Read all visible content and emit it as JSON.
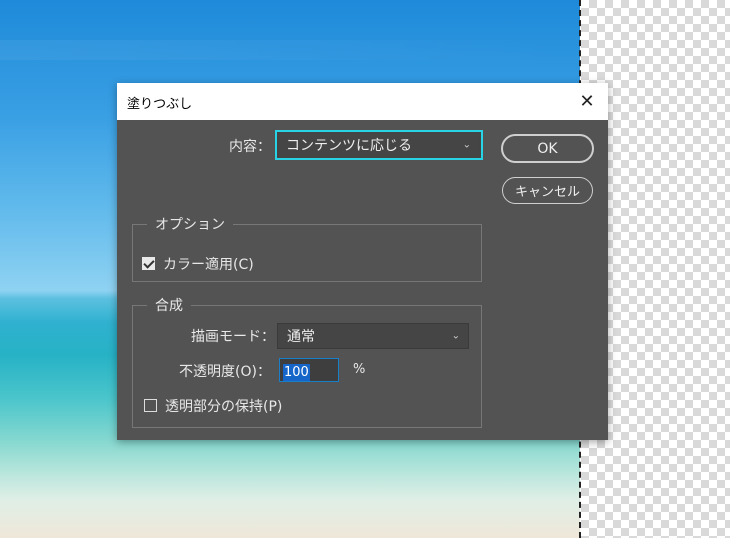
{
  "dialog": {
    "title": "塗りつぶし",
    "close_glyph": "✕",
    "contents_label": "内容：",
    "contents_value": "コンテンツに応じる",
    "ok_label": "OK",
    "cancel_label": "キャンセル",
    "options_group": {
      "title": "オプション",
      "color_adapt_label": "カラー適用(C)",
      "color_adapt_checked": true
    },
    "blending_group": {
      "title": "合成",
      "mode_label": "描画モード：",
      "mode_value": "通常",
      "opacity_label": "不透明度(O)：",
      "opacity_value": "100",
      "opacity_unit": "%",
      "preserve_transparency_label": "透明部分の保持(P)",
      "preserve_transparency_checked": false
    }
  },
  "colors": {
    "dialog_bg": "#535353",
    "focus_ring": "#29d3e6",
    "selection_highlight": "#1666c9"
  },
  "icons": {
    "close": "close-icon",
    "dropdown": "chevron-down-icon",
    "check": "checkmark-icon"
  }
}
